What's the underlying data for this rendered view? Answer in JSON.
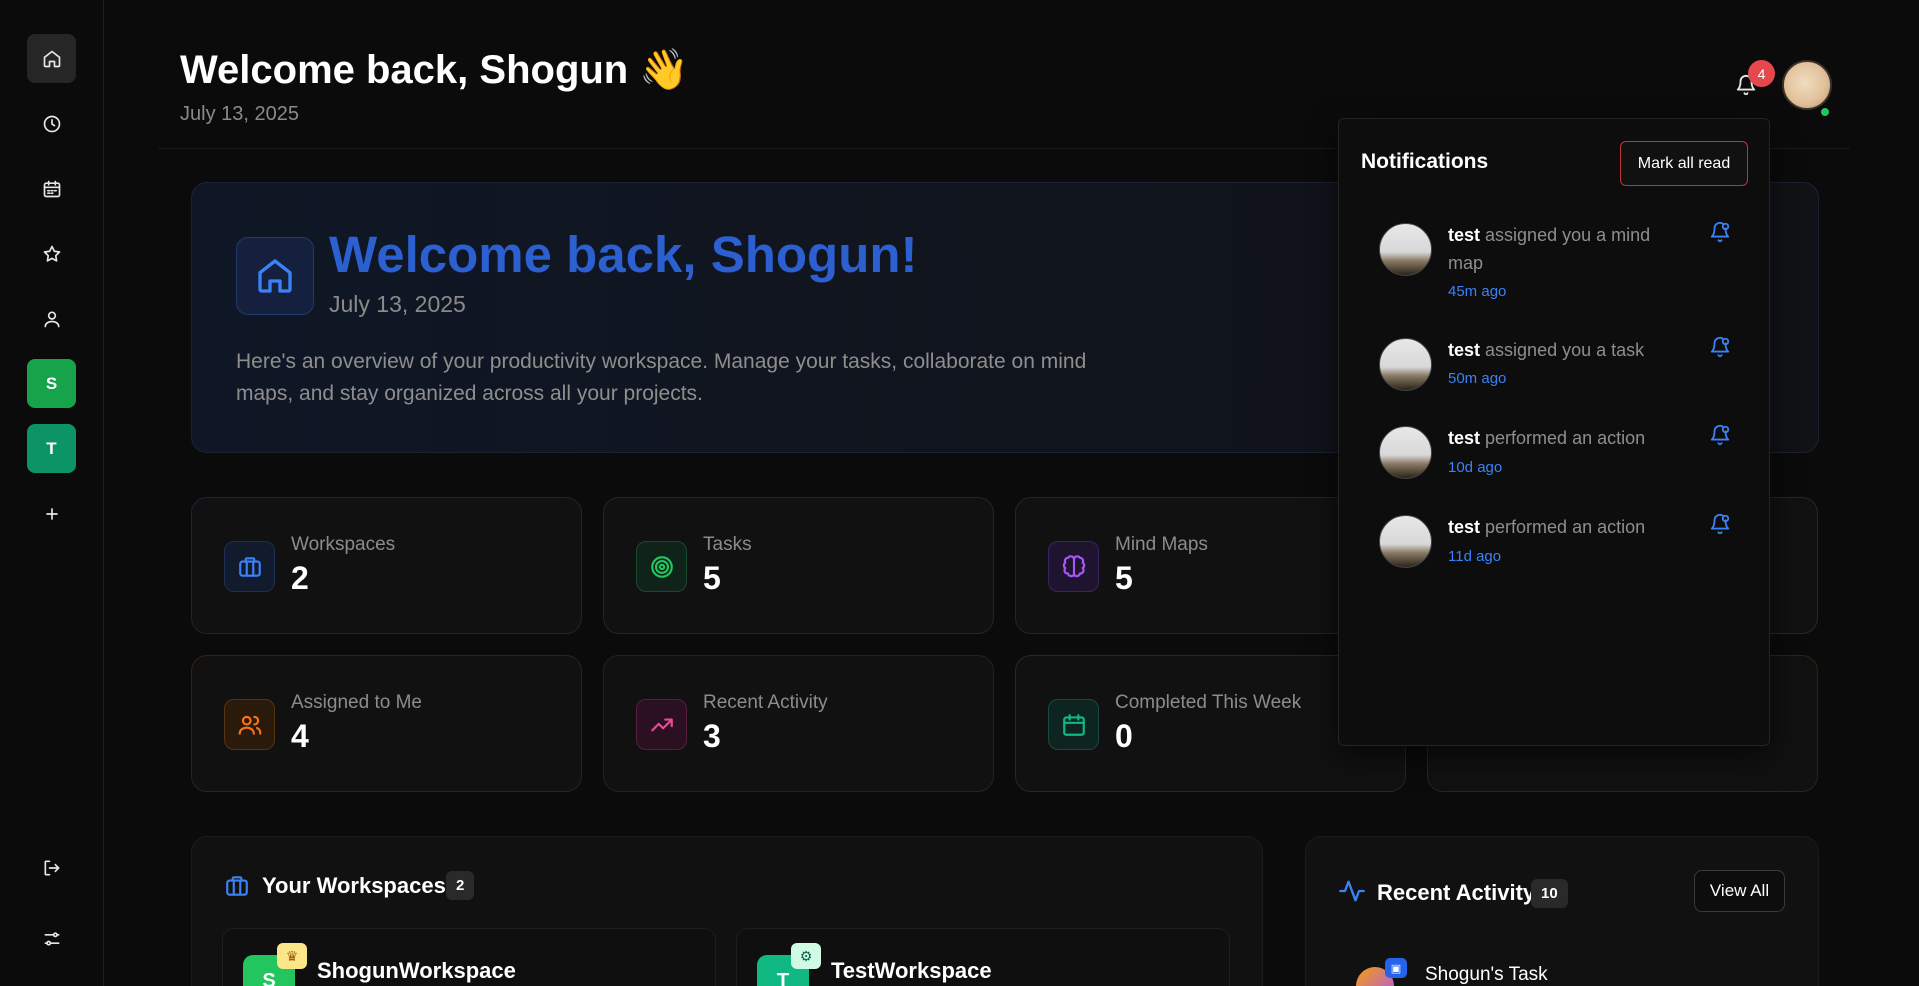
{
  "header": {
    "title": "Welcome back, Shogun",
    "wave_emoji": "👋",
    "date": "July 13, 2025",
    "notification_count": "4"
  },
  "sidebar": {
    "items": [
      {
        "icon": "home-icon"
      },
      {
        "icon": "clock-icon"
      },
      {
        "icon": "calendar-icon"
      },
      {
        "icon": "star-icon"
      },
      {
        "icon": "user-icon"
      }
    ],
    "workspaces": [
      {
        "letter": "S",
        "color": "#16a34a"
      },
      {
        "letter": "T",
        "color": "#0d9466"
      }
    ],
    "add_icon": "plus-icon",
    "logout_icon": "logout-icon",
    "settings_icon": "sliders-icon"
  },
  "hero": {
    "title": "Welcome back, Shogun!",
    "date": "July 13, 2025",
    "description": "Here's an overview of your productivity workspace. Manage your tasks, collaborate on mind maps, and stay organized across all your projects."
  },
  "stats": [
    {
      "label": "Workspaces",
      "value": "2",
      "icon": "briefcase-icon",
      "color": "#3b82f6"
    },
    {
      "label": "Tasks",
      "value": "5",
      "icon": "target-icon",
      "color": "#22c55e"
    },
    {
      "label": "Mind Maps",
      "value": "5",
      "icon": "brain-icon",
      "color": "#a855f7"
    },
    {
      "label": "Assigned to Me",
      "value": "4",
      "icon": "users-icon",
      "color": "#f97316"
    },
    {
      "label": "Recent Activity",
      "value": "3",
      "icon": "trending-up-icon",
      "color": "#ec4899"
    },
    {
      "label": "Completed This Week",
      "value": "0",
      "icon": "calendar-icon",
      "color": "#10b981"
    }
  ],
  "workspaces_panel": {
    "title": "Your Workspaces",
    "count": "2",
    "cards": [
      {
        "letter": "S",
        "name": "ShogunWorkspace",
        "badge": "crown"
      },
      {
        "letter": "T",
        "name": "TestWorkspace",
        "badge": "gear"
      }
    ]
  },
  "activity_panel": {
    "title": "Recent Activity",
    "count": "10",
    "view_all": "View All",
    "first_item": "Shogun's Task"
  },
  "notifications": {
    "title": "Notifications",
    "mark_all": "Mark all read",
    "items": [
      {
        "user": "test",
        "text": "assigned you a mind map",
        "time": "45m ago"
      },
      {
        "user": "test",
        "text": "assigned you a task",
        "time": "50m ago"
      },
      {
        "user": "test",
        "text": "performed an action",
        "time": "10d ago"
      },
      {
        "user": "test",
        "text": "performed an action",
        "time": "11d ago"
      }
    ]
  }
}
